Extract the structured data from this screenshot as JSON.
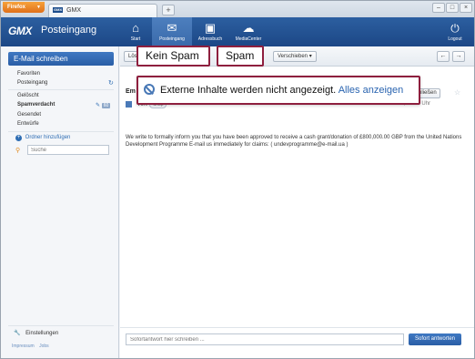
{
  "browser": {
    "menu_label": "Firefox",
    "tab_title": "GMX",
    "favicon_text": "GMX",
    "new_tab": "+"
  },
  "header": {
    "logo": "GMX",
    "title": "Posteingang",
    "nav": [
      {
        "label": "Start",
        "icon": "home-icon"
      },
      {
        "label": "Posteingang",
        "icon": "mail-icon"
      },
      {
        "label": "Adressbuch",
        "icon": "contacts-icon"
      },
      {
        "label": "MediaCenter",
        "icon": "cloud-icon"
      }
    ],
    "logout": "Logout"
  },
  "sidebar": {
    "compose": "E-Mail schreiben",
    "folders": [
      {
        "label": "Favoriten"
      },
      {
        "label": "Posteingang"
      },
      {
        "label": "Gelöscht"
      },
      {
        "label": "Spamverdacht",
        "badge": "60"
      },
      {
        "label": "Gesendet"
      },
      {
        "label": "Entwürfe"
      }
    ],
    "add_folder": "Ordner hinzufügen",
    "search_placeholder": "Suche",
    "settings": "Einstellungen",
    "footer": [
      "Impressum",
      "Jobs"
    ]
  },
  "toolbar": {
    "delete_label": "Lösc",
    "move_label": "Verschieben",
    "prev_arrow": "←",
    "next_arrow": "→"
  },
  "message": {
    "subject_prefix": "Em",
    "from_label": "Von:",
    "sender_pill": "undp",
    "date": "Gestern, 14:00 Uhr",
    "reply_label": "schließen",
    "body": "We write to formally inform you that you have been approved to receive a cash grant/donation of £800,000.00 GBP from the United Nations Development Programme E-mail us immediately for claims: ( undevprogramme@e-mail.ua )",
    "quick_reply_placeholder": "Sofortantwort hier schreiben ...",
    "quick_reply_button": "Sofort antworten"
  },
  "overlay": {
    "not_spam": "Kein Spam",
    "spam": "Spam",
    "notice_text": "Externe Inhalte werden nicht angezeigt.",
    "notice_link": "Alles anzeigen"
  },
  "colors": {
    "brand_blue": "#1c4786",
    "accent_blue": "#2a5ea6",
    "callout_border": "#8e1f3e",
    "firefox_orange": "#e0701a"
  }
}
